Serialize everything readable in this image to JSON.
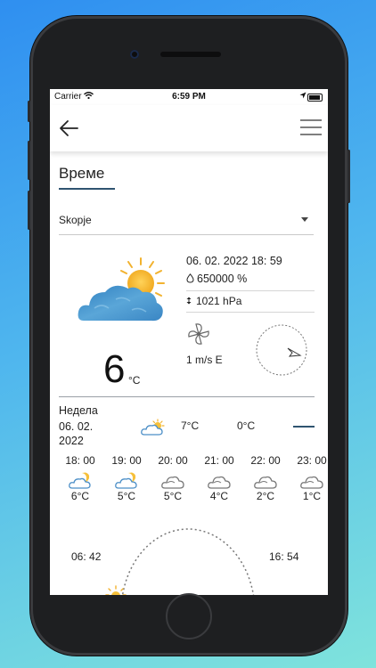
{
  "status_bar": {
    "carrier": "Carrier",
    "time": "6:59 PM"
  },
  "page": {
    "title": "Време"
  },
  "location": {
    "selected": "Skopje"
  },
  "current": {
    "temperature": "6",
    "unit": "°C",
    "datetime": "06. 02. 2022 18: 59",
    "humidity": "650000 %",
    "pressure": "1021 hPa",
    "wind": "1 m/s E",
    "icon": "partly-cloudy-icon"
  },
  "day": {
    "name": "Недела",
    "date": "06. 02. 2022",
    "max": "7°C",
    "min": "0°C",
    "icon": "partly-cloudy-icon"
  },
  "hourly": [
    {
      "time": "18: 00",
      "temp": "6°C",
      "icon": "cloud-moon-icon"
    },
    {
      "time": "19: 00",
      "temp": "5°C",
      "icon": "cloud-moon-icon"
    },
    {
      "time": "20: 00",
      "temp": "5°C",
      "icon": "cloud-icon"
    },
    {
      "time": "21: 00",
      "temp": "4°C",
      "icon": "cloud-icon"
    },
    {
      "time": "22: 00",
      "temp": "2°C",
      "icon": "cloud-icon"
    },
    {
      "time": "23: 00",
      "temp": "1°C",
      "icon": "cloud-icon"
    }
  ],
  "sun": {
    "sunrise": "06: 42",
    "sunset": "16: 54"
  },
  "colors": {
    "accent": "#2f5470",
    "icon_blue": "#4c8fc7",
    "sun": "#f2b22e"
  }
}
